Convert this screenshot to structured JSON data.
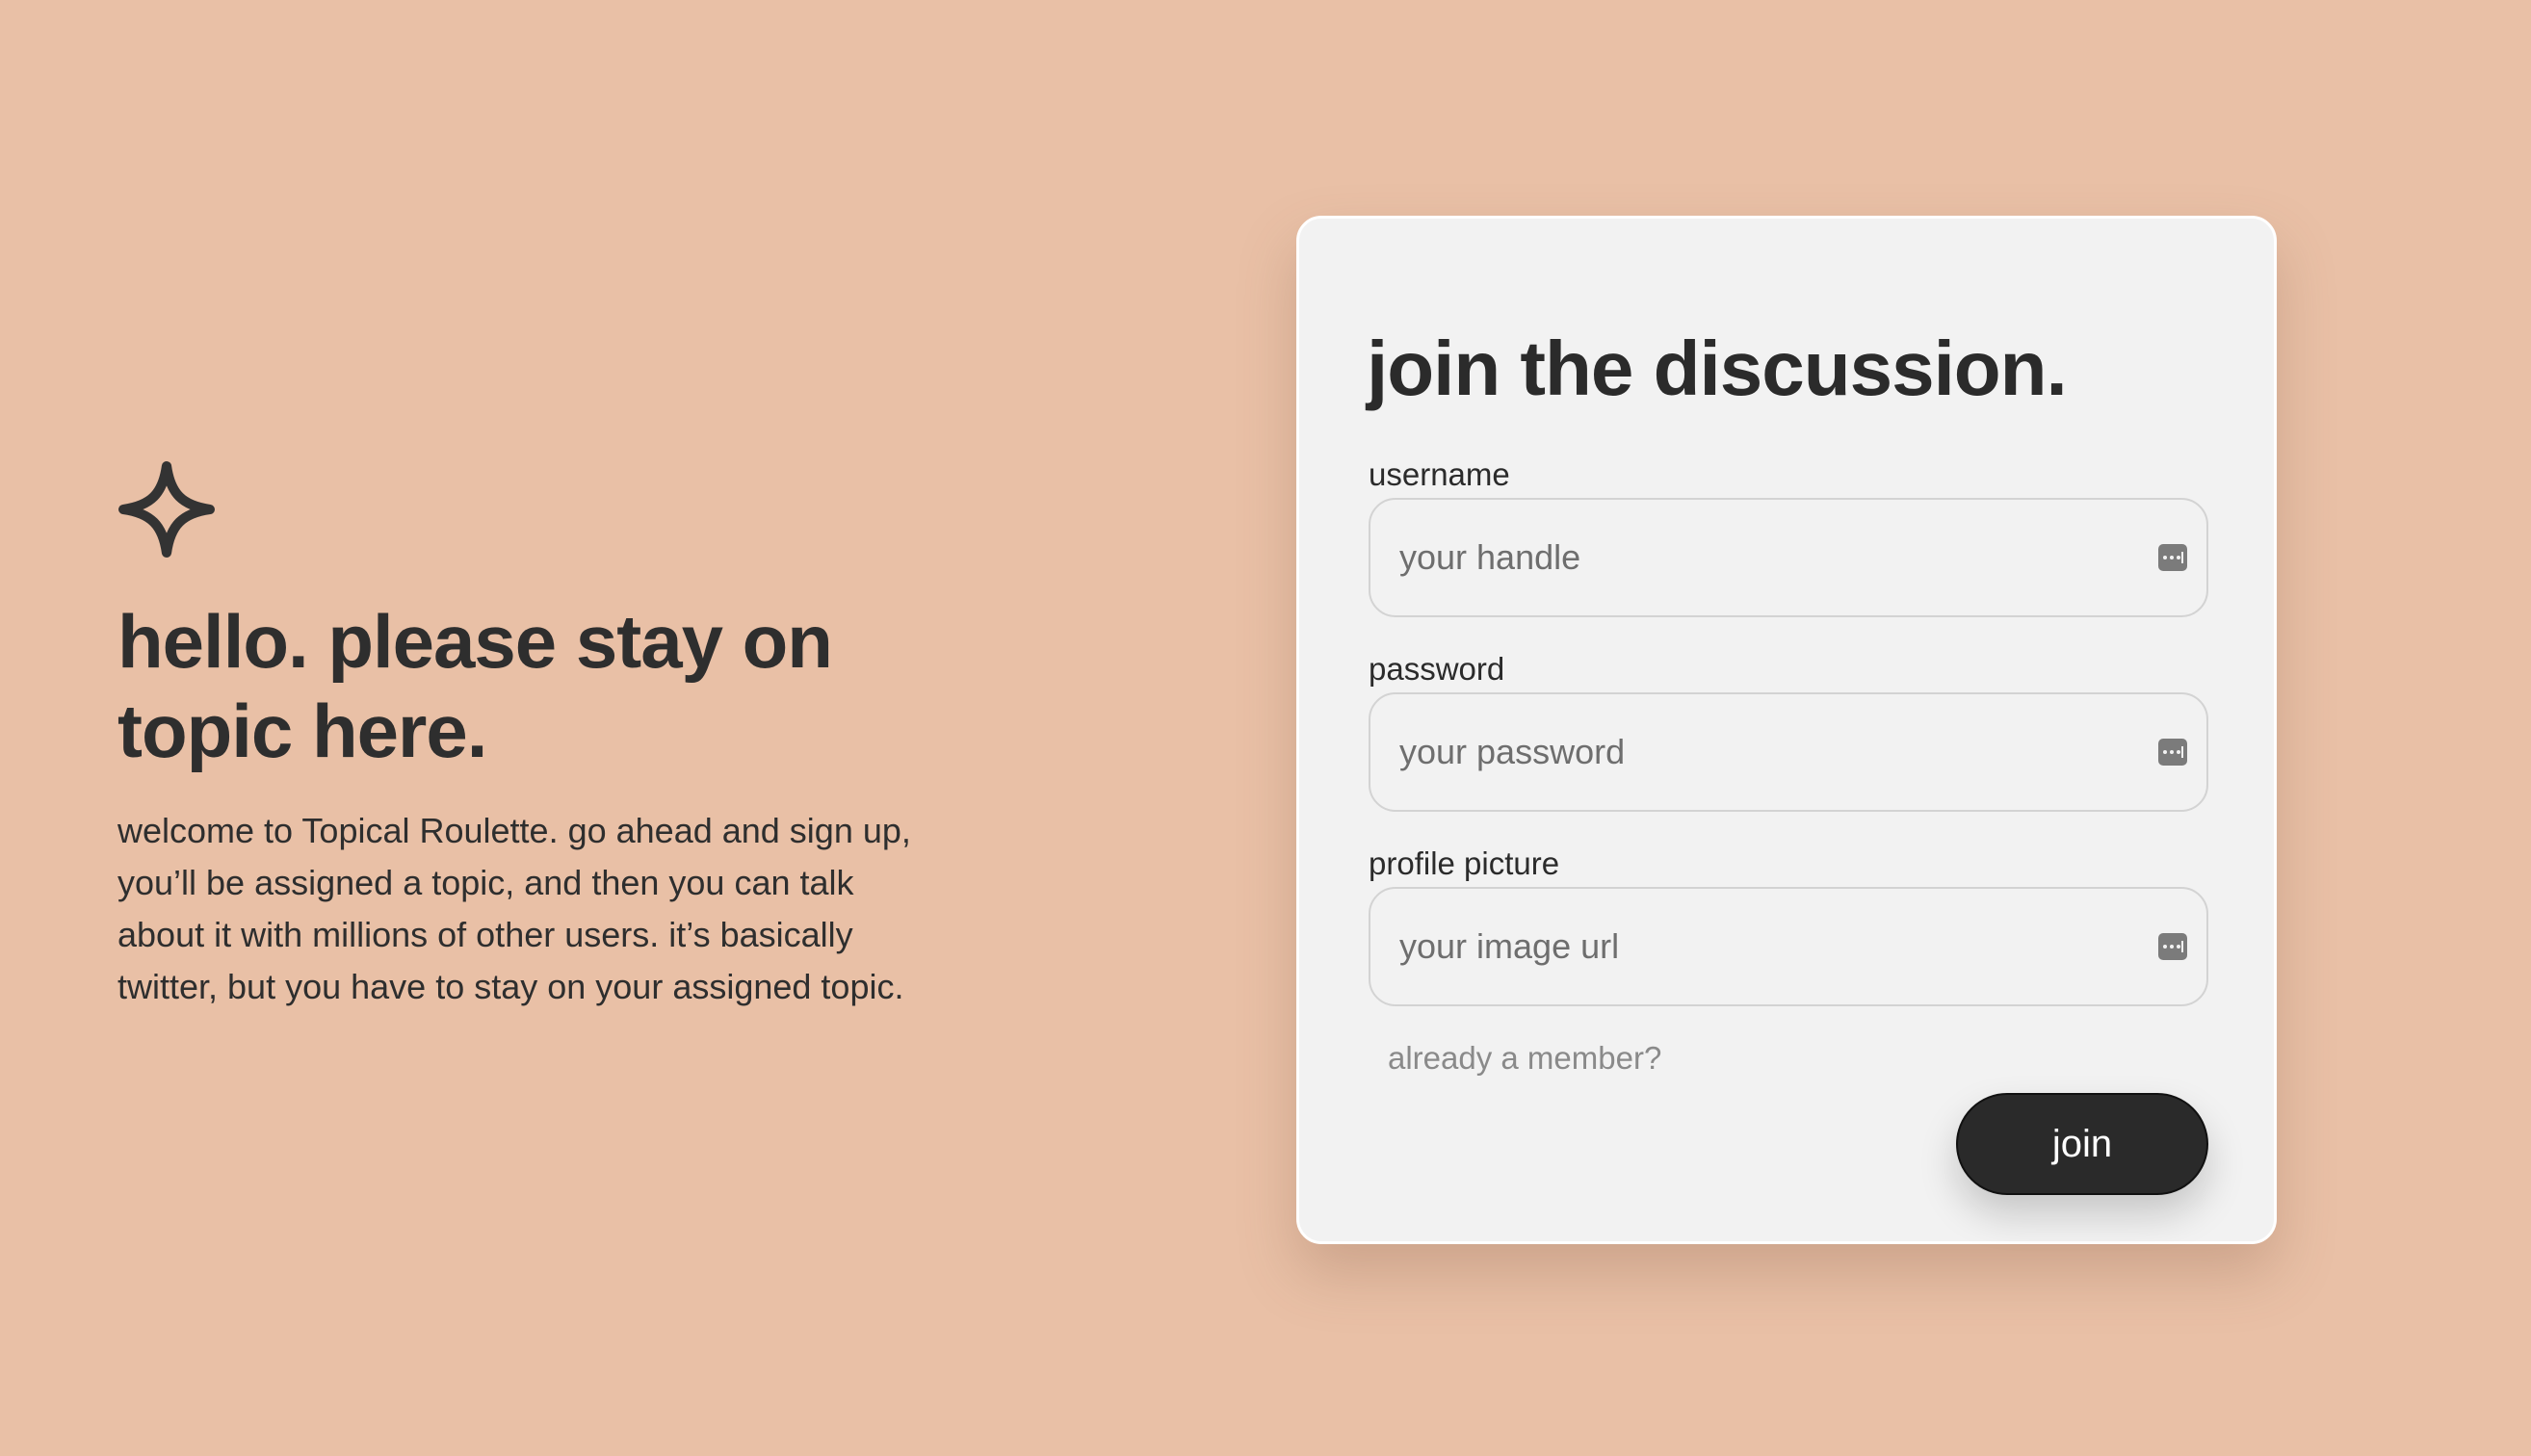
{
  "hero": {
    "logo_icon": "sparkle-icon",
    "headline": "hello. please stay on topic here.",
    "description": "welcome to Topical Roulette. go ahead and sign up, you’ll be assigned a topic, and then you can talk about it with millions of other users. it’s basically twitter, but you have to stay on your assigned topic."
  },
  "signup": {
    "title": "join the discussion.",
    "fields": [
      {
        "label": "username",
        "placeholder": "your handle",
        "value": "",
        "icon": "autofill-key-icon"
      },
      {
        "label": "password",
        "placeholder": "your password",
        "value": "",
        "icon": "autofill-key-icon"
      },
      {
        "label": "profile picture",
        "placeholder": "your image url",
        "value": "",
        "icon": "autofill-key-icon"
      }
    ],
    "member_link": "already a member?",
    "submit_label": "join"
  },
  "colors": {
    "background": "#e9c0a6",
    "card": "#f2f2f2",
    "text": "#2b2b2b",
    "button": "#2a2a2a",
    "muted_link": "#8a8a8a"
  }
}
